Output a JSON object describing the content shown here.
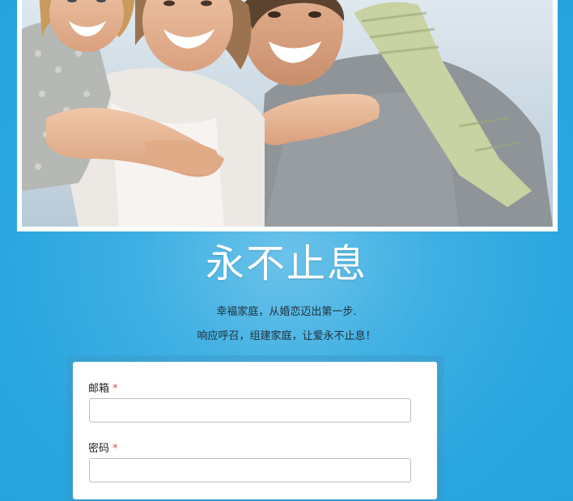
{
  "hero": {
    "headline": "永不止息",
    "line1": "幸福家庭，从婚恋迈出第一步.",
    "line2": "响应呼召，组建家庭，让爱永不止息！"
  },
  "form": {
    "email_label": "邮箱",
    "password_label": "密码",
    "required_mark": "*",
    "email_value": "",
    "password_value": ""
  },
  "colors": {
    "background": "#2aa6df",
    "required": "#e0474c",
    "headline": "#ffffff"
  }
}
